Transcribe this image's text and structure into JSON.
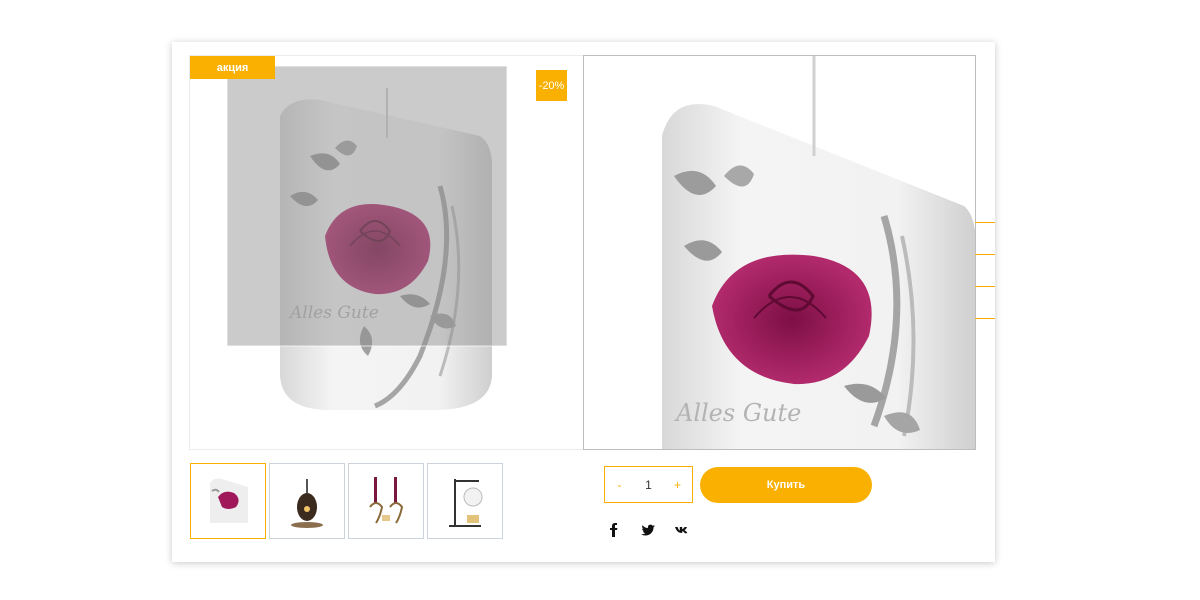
{
  "product": {
    "badge_sale": "акция",
    "badge_discount": "-20%",
    "main_image": {
      "alt": "Свеча с розой Alles Gute"
    },
    "thumbnails": [
      {
        "icon": "rose-candle-thumb",
        "active": true
      },
      {
        "icon": "lantern-thumb",
        "active": false
      },
      {
        "icon": "candelabra-thumb",
        "active": false
      },
      {
        "icon": "glass-lamp-thumb",
        "active": false
      }
    ],
    "image_text": "Alles Gute"
  },
  "purchase": {
    "minus": "-",
    "quantity": "1",
    "plus": "+",
    "buy_label": "Купить"
  },
  "share": {
    "icons": [
      "facebook-icon",
      "twitter-icon",
      "vk-icon"
    ]
  },
  "colors": {
    "accent": "#f9b000",
    "rose": "#a0185a"
  }
}
